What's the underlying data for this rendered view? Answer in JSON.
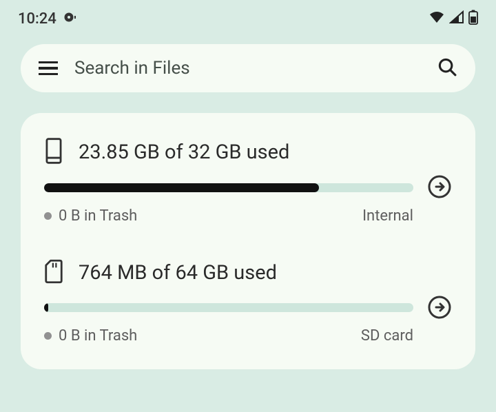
{
  "status_bar": {
    "time": "10:24"
  },
  "search": {
    "placeholder": "Search in Files"
  },
  "storage": [
    {
      "icon": "phone",
      "title": "23.85 GB of 32 GB used",
      "progress_percent": 74.5,
      "trash": "0 B in Trash",
      "type": "Internal"
    },
    {
      "icon": "sd",
      "title": "764 MB of 64 GB used",
      "progress_percent": 1.2,
      "trash": "0 B in Trash",
      "type": "SD card"
    }
  ]
}
